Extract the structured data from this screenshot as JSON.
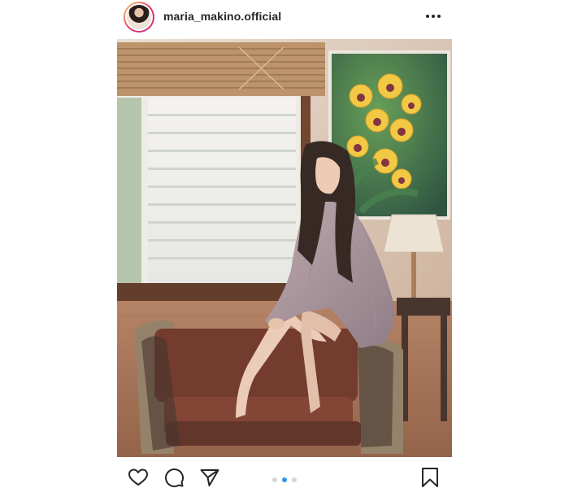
{
  "post": {
    "username": "maria_makino.official",
    "avatar_icon": "profile-avatar",
    "more_icon": "more-horizontal-icon"
  },
  "actions": {
    "like_icon": "heart-icon",
    "comment_icon": "comment-icon",
    "share_icon": "send-icon",
    "save_icon": "bookmark-icon"
  },
  "carousel": {
    "total": 3,
    "current": 2
  },
  "colors": {
    "carousel_active": "#2f95f0",
    "carousel_inactive": "#d6d6d6",
    "text": "#262626"
  }
}
